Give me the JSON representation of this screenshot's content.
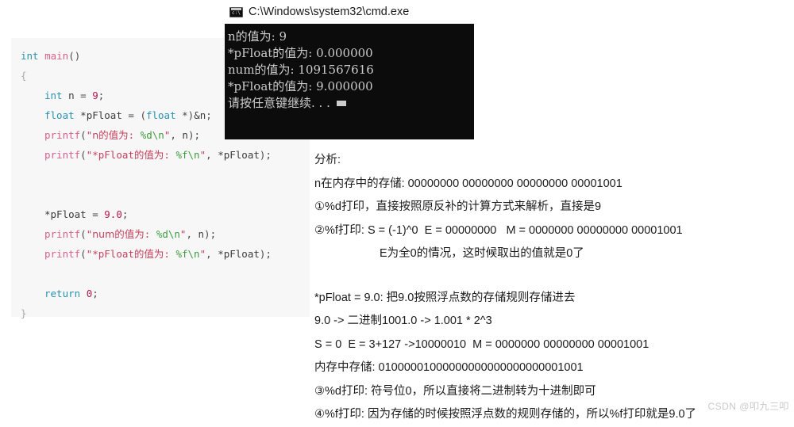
{
  "console": {
    "icon": "cmd-icon",
    "title": "C:\\Windows\\system32\\cmd.exe",
    "lines": [
      "n的值为: 9",
      "*pFloat的值为: 0.000000",
      "num的值为: 1091567616",
      "*pFloat的值为: 9.000000",
      "请按任意键继续. . ."
    ],
    "cursor": "block-cursor"
  },
  "code": {
    "lines": [
      {
        "indent": 0,
        "tokens": [
          {
            "t": "int ",
            "c": "tok-type"
          },
          {
            "t": "main",
            "c": "tok-fn"
          },
          {
            "t": "()",
            "c": "tok-punct"
          }
        ]
      },
      {
        "indent": 0,
        "tokens": [
          {
            "t": "{",
            "c": "tok-brace"
          }
        ]
      },
      {
        "indent": 1,
        "tokens": [
          {
            "t": "int",
            "c": "tok-type"
          },
          {
            "t": " n ",
            "c": "tok-id"
          },
          {
            "t": "= ",
            "c": "tok-punct"
          },
          {
            "t": "9",
            "c": "tok-num"
          },
          {
            "t": ";",
            "c": "tok-punct"
          }
        ]
      },
      {
        "indent": 1,
        "tokens": [
          {
            "t": "float",
            "c": "tok-type"
          },
          {
            "t": " *pFloat ",
            "c": "tok-id"
          },
          {
            "t": "= ",
            "c": "tok-punct"
          },
          {
            "t": "(",
            "c": "tok-punct"
          },
          {
            "t": "float",
            "c": "tok-type"
          },
          {
            "t": " *)",
            "c": "tok-punct"
          },
          {
            "t": "&n",
            "c": "tok-id"
          },
          {
            "t": ";",
            "c": "tok-punct"
          }
        ]
      },
      {
        "indent": 1,
        "tokens": [
          {
            "t": "printf",
            "c": "tok-fn"
          },
          {
            "t": "(",
            "c": "tok-punct"
          },
          {
            "t": "\"",
            "c": "tok-str"
          },
          {
            "t": "n的值为",
            "c": "tok-cn"
          },
          {
            "t": ": ",
            "c": "tok-str"
          },
          {
            "t": "%d\\n",
            "c": "tok-fmt"
          },
          {
            "t": "\"",
            "c": "tok-str"
          },
          {
            "t": ", ",
            "c": "tok-punct"
          },
          {
            "t": "n",
            "c": "tok-id"
          },
          {
            "t": ");",
            "c": "tok-punct"
          }
        ]
      },
      {
        "indent": 1,
        "tokens": [
          {
            "t": "printf",
            "c": "tok-fn"
          },
          {
            "t": "(",
            "c": "tok-punct"
          },
          {
            "t": "\"*pFloat",
            "c": "tok-str"
          },
          {
            "t": "的值为",
            "c": "tok-cn"
          },
          {
            "t": ": ",
            "c": "tok-str"
          },
          {
            "t": "%f\\n",
            "c": "tok-fmt"
          },
          {
            "t": "\"",
            "c": "tok-str"
          },
          {
            "t": ", ",
            "c": "tok-punct"
          },
          {
            "t": "*pFloat",
            "c": "tok-id"
          },
          {
            "t": ");",
            "c": "tok-punct"
          }
        ]
      },
      {
        "blank": true
      },
      {
        "blank": true
      },
      {
        "indent": 1,
        "tokens": [
          {
            "t": "*pFloat ",
            "c": "tok-id"
          },
          {
            "t": "= ",
            "c": "tok-punct"
          },
          {
            "t": "9.0",
            "c": "tok-num"
          },
          {
            "t": ";",
            "c": "tok-punct"
          }
        ]
      },
      {
        "indent": 1,
        "tokens": [
          {
            "t": "printf",
            "c": "tok-fn"
          },
          {
            "t": "(",
            "c": "tok-punct"
          },
          {
            "t": "\"",
            "c": "tok-str"
          },
          {
            "t": "num的值为",
            "c": "tok-cn"
          },
          {
            "t": ": ",
            "c": "tok-str"
          },
          {
            "t": "%d\\n",
            "c": "tok-fmt"
          },
          {
            "t": "\"",
            "c": "tok-str"
          },
          {
            "t": ", ",
            "c": "tok-punct"
          },
          {
            "t": "n",
            "c": "tok-id"
          },
          {
            "t": ");",
            "c": "tok-punct"
          }
        ]
      },
      {
        "indent": 1,
        "tokens": [
          {
            "t": "printf",
            "c": "tok-fn"
          },
          {
            "t": "(",
            "c": "tok-punct"
          },
          {
            "t": "\"*pFloat",
            "c": "tok-str"
          },
          {
            "t": "的值为",
            "c": "tok-cn"
          },
          {
            "t": ": ",
            "c": "tok-str"
          },
          {
            "t": "%f\\n",
            "c": "tok-fmt"
          },
          {
            "t": "\"",
            "c": "tok-str"
          },
          {
            "t": ", ",
            "c": "tok-punct"
          },
          {
            "t": "*pFloat",
            "c": "tok-id"
          },
          {
            "t": ");",
            "c": "tok-punct"
          }
        ]
      },
      {
        "blank": true
      },
      {
        "indent": 1,
        "tokens": [
          {
            "t": "return",
            "c": "tok-kw"
          },
          {
            "t": " ",
            "c": "tok-id"
          },
          {
            "t": "0",
            "c": "tok-num"
          },
          {
            "t": ";",
            "c": "tok-punct"
          }
        ]
      },
      {
        "indent": 0,
        "tokens": [
          {
            "t": "}",
            "c": "tok-brace"
          }
        ]
      }
    ]
  },
  "analysis": {
    "lines": [
      {
        "text": "分析:",
        "indent": false
      },
      {
        "text": "n在内存中的存储: 00000000 00000000 00000000 00001001",
        "indent": false
      },
      {
        "text": "①%d打印，直接按照原反补的计算方式来解析，直接是9",
        "indent": false
      },
      {
        "text": "②%f打印: S = (-1)^0  E = 00000000   M = 0000000 00000000 00001001",
        "indent": false
      },
      {
        "text": "E为全0的情况，这时候取出的值就是0了",
        "indent": true
      },
      {
        "gap": true
      },
      {
        "text": "*pFloat = 9.0: 把9.0按照浮点数的存储规则存储进去",
        "indent": false
      },
      {
        "text": "9.0 -> 二进制1001.0 -> 1.001 * 2^3",
        "indent": false
      },
      {
        "text": "S = 0  E = 3+127 ->10000010  M = 0000000 00000000 00001001",
        "indent": false
      },
      {
        "text": "内存中存储: 01000001000000000000000000001001",
        "indent": false
      },
      {
        "text": "③%d打印: 符号位0，所以直接将二进制转为十进制即可",
        "indent": false
      },
      {
        "text": "④%f打印: 因为存储的时候按照浮点数的规则存储的，所以%f打印就是9.0了",
        "indent": false
      }
    ]
  },
  "watermark": {
    "text": "CSDN @叩九三叩"
  }
}
